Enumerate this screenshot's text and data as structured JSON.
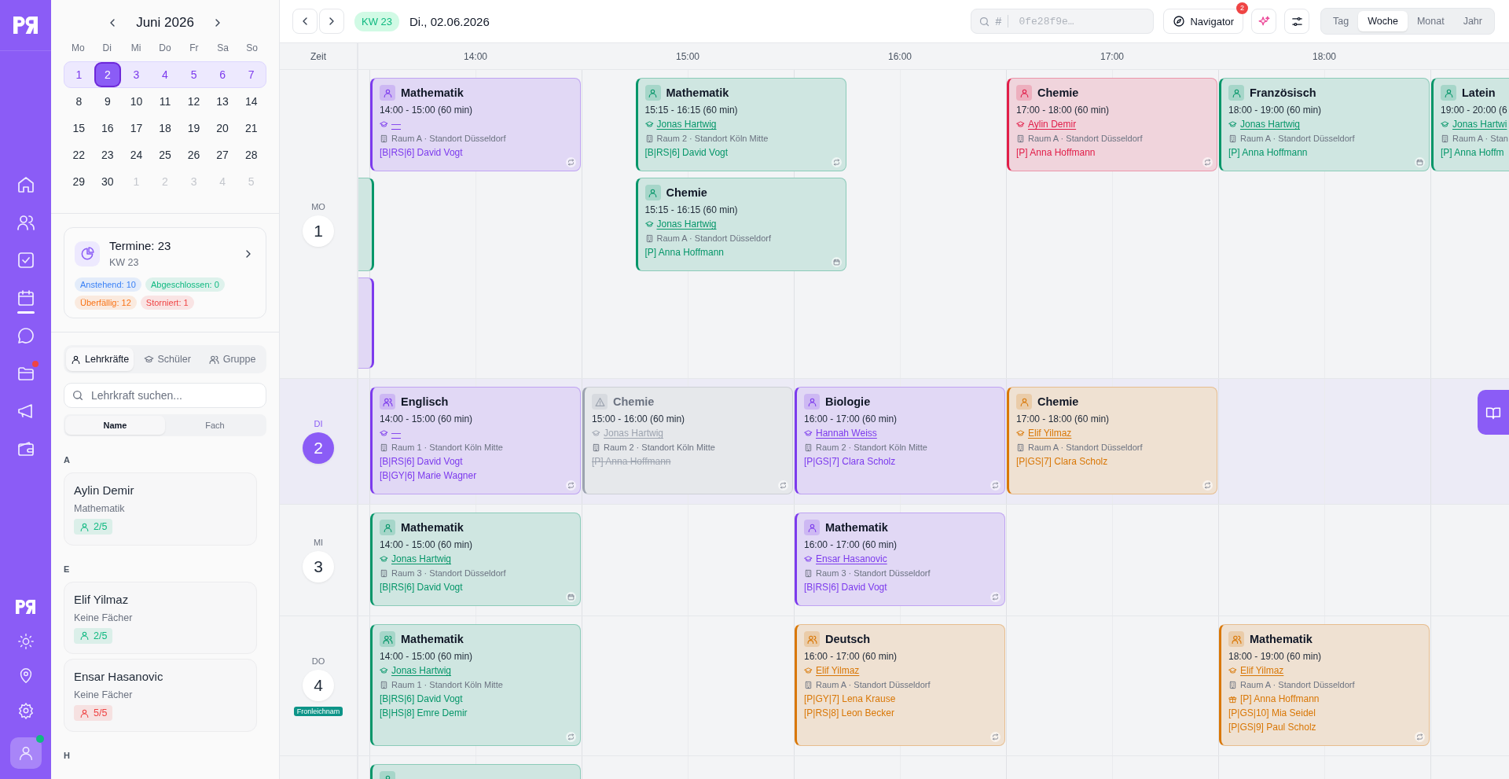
{
  "rail": {
    "items": [
      {
        "selected": false,
        "notification": false
      },
      {
        "selected": false,
        "notification": false
      },
      {
        "selected": false,
        "notification": false
      },
      {
        "selected": true,
        "notification": false
      },
      {
        "selected": false,
        "notification": false
      },
      {
        "selected": false,
        "notification": true
      },
      {
        "selected": false,
        "notification": false
      },
      {
        "selected": false,
        "notification": false
      }
    ],
    "user": {
      "online": true
    }
  },
  "mini_calendar": {
    "month": "Juni 2026",
    "weekdays": [
      "Mo",
      "Di",
      "Mi",
      "Do",
      "Fr",
      "Sa",
      "So"
    ],
    "weeks": [
      {
        "selected": true,
        "days": [
          {
            "label": "1",
            "selected": false,
            "outside": false
          },
          {
            "label": "2",
            "selected": true,
            "outside": false
          },
          {
            "label": "3",
            "selected": false,
            "outside": false
          },
          {
            "label": "4",
            "selected": false,
            "outside": false
          },
          {
            "label": "5",
            "selected": false,
            "outside": false
          },
          {
            "label": "6",
            "selected": false,
            "outside": false
          },
          {
            "label": "7",
            "selected": false,
            "outside": false
          }
        ]
      },
      {
        "selected": false,
        "days": [
          {
            "label": "8",
            "selected": false,
            "outside": false
          },
          {
            "label": "9",
            "selected": false,
            "outside": false
          },
          {
            "label": "10",
            "selected": false,
            "outside": false
          },
          {
            "label": "11",
            "selected": false,
            "outside": false
          },
          {
            "label": "12",
            "selected": false,
            "outside": false
          },
          {
            "label": "13",
            "selected": false,
            "outside": false
          },
          {
            "label": "14",
            "selected": false,
            "outside": false
          }
        ]
      },
      {
        "selected": false,
        "days": [
          {
            "label": "15",
            "selected": false,
            "outside": false
          },
          {
            "label": "16",
            "selected": false,
            "outside": false
          },
          {
            "label": "17",
            "selected": false,
            "outside": false
          },
          {
            "label": "18",
            "selected": false,
            "outside": false
          },
          {
            "label": "19",
            "selected": false,
            "outside": false
          },
          {
            "label": "20",
            "selected": false,
            "outside": false
          },
          {
            "label": "21",
            "selected": false,
            "outside": false
          }
        ]
      },
      {
        "selected": false,
        "days": [
          {
            "label": "22",
            "selected": false,
            "outside": false
          },
          {
            "label": "23",
            "selected": false,
            "outside": false
          },
          {
            "label": "24",
            "selected": false,
            "outside": false
          },
          {
            "label": "25",
            "selected": false,
            "outside": false
          },
          {
            "label": "26",
            "selected": false,
            "outside": false
          },
          {
            "label": "27",
            "selected": false,
            "outside": false
          },
          {
            "label": "28",
            "selected": false,
            "outside": false
          }
        ]
      },
      {
        "selected": false,
        "days": [
          {
            "label": "29",
            "selected": false,
            "outside": false
          },
          {
            "label": "30",
            "selected": false,
            "outside": false
          },
          {
            "label": "1",
            "selected": false,
            "outside": true
          },
          {
            "label": "2",
            "selected": false,
            "outside": true
          },
          {
            "label": "3",
            "selected": false,
            "outside": true
          },
          {
            "label": "4",
            "selected": false,
            "outside": true
          },
          {
            "label": "5",
            "selected": false,
            "outside": true
          }
        ]
      }
    ]
  },
  "summary": {
    "title": "Termine: 23",
    "subtitle": "KW 23",
    "chips": [
      {
        "label": "Anstehend: 10",
        "color": "#3b82f6"
      },
      {
        "label": "Abgeschlossen: 0",
        "color": "#10b981"
      },
      {
        "label": "Überfällig: 12",
        "color": "#f97316"
      },
      {
        "label": "Storniert: 1",
        "color": "#ef4444"
      }
    ]
  },
  "people_tabs": [
    {
      "label": "Lehrkräfte",
      "selected": true
    },
    {
      "label": "Schüler",
      "selected": false
    },
    {
      "label": "Gruppe",
      "selected": false
    }
  ],
  "people_search": {
    "placeholder": "Lehrkraft suchen..."
  },
  "sort": [
    {
      "label": "Name",
      "selected": true
    },
    {
      "label": "Fach",
      "selected": false
    }
  ],
  "groups": [
    {
      "letter": "A",
      "teachers": [
        {
          "name": "Aylin Demir",
          "subject": "Mathematik",
          "load": "2/5",
          "color": "#10b981"
        }
      ]
    },
    {
      "letter": "E",
      "teachers": [
        {
          "name": "Elif Yilmaz",
          "subject": "Keine Fächer",
          "load": "2/5",
          "color": "#10b981"
        },
        {
          "name": "Ensar Hasanovic",
          "subject": "Keine Fächer",
          "load": "5/5",
          "color": "#ef4444"
        }
      ]
    },
    {
      "letter": "H"
    }
  ],
  "toolbar": {
    "week_badge": "KW 23",
    "date": "Di., 02.06.2026",
    "search": {
      "prefix": "#",
      "placeholder": "0fe28f9e…"
    },
    "navigator": {
      "label": "Navigator",
      "badge": "2"
    },
    "views": [
      {
        "label": "Tag",
        "selected": false
      },
      {
        "label": "Woche",
        "selected": true
      },
      {
        "label": "Monat",
        "selected": false
      },
      {
        "label": "Jahr",
        "selected": false
      }
    ]
  },
  "grid": {
    "time_header": "Zeit",
    "hours": [
      "14:00",
      "15:00",
      "16:00",
      "17:00",
      "18:00"
    ],
    "days": [
      {
        "weekday": "MO",
        "date": "1",
        "selected": false,
        "lanes": [
          [
            {
              "kind": "full",
              "color": "#7c3aed",
              "title": "Mathematik",
              "time": "14:00 - 15:00 (60 min)",
              "teacher": "—",
              "room": "Raum A · Standort Düsseldorf",
              "participants": [
                {
                  "text": "[B|RS|6] David Vogt",
                  "gift": false
                }
              ],
              "recurring": true,
              "cancelled": false
            },
            {
              "kind": "full",
              "color": "#059669",
              "title": "Mathematik",
              "time": "15:15 - 16:15 (60 min)",
              "teacher": "Jonas Hartwig",
              "room": "Raum 2 · Standort Köln Mitte",
              "participants": [
                {
                  "text": "[B|RS|6] David Vogt",
                  "gift": false
                }
              ],
              "recurring": true,
              "cancelled": false
            },
            {
              "kind": "full",
              "color": "#e11d48",
              "title": "Chemie",
              "time": "17:00 - 18:00 (60 min)",
              "teacher": "Aylin Demir",
              "room": "Raum A · Standort Düsseldorf",
              "participants": [
                {
                  "text": "[P] Anna Hoffmann",
                  "gift": false
                }
              ],
              "recurring": true,
              "cancelled": false
            },
            {
              "kind": "full",
              "color": "#059669",
              "title": "Französisch",
              "time": "18:00 - 19:00 (60 min)",
              "teacher": "Jonas Hartwig",
              "room": "Raum A · Standort Düsseldorf",
              "participants": [
                {
                  "text": "[P] Anna Hoffmann",
                  "gift": false
                }
              ],
              "recurring": false,
              "cancelled": false
            },
            {
              "kind": "full",
              "color": "#059669",
              "title": "Latein",
              "time": "19:00 - 20:00 (6",
              "teacher": "Jonas Hartwi",
              "room": "Raum A · Stan",
              "participants": [
                {
                  "text": "[P] Anna Hoffm",
                  "gift": false
                }
              ],
              "cancelled": false
            }
          ],
          [
            {
              "kind": "cut",
              "color": "#059669"
            },
            {
              "kind": "full",
              "color": "#059669",
              "title": "Chemie",
              "time": "15:15 - 16:15 (60 min)",
              "teacher": "Jonas Hartwig",
              "room": "Raum A · Standort Düsseldorf",
              "participants": [
                {
                  "text": "[P] Anna Hoffmann",
                  "gift": false
                }
              ],
              "recurring": false,
              "cancelled": false
            }
          ],
          [
            {
              "kind": "cut",
              "color": "#7c3aed"
            }
          ]
        ]
      },
      {
        "weekday": "DI",
        "date": "2",
        "selected": true,
        "lanes": [
          [
            {
              "kind": "full",
              "color": "#7c3aed",
              "title": "Englisch",
              "time": "14:00 - 15:00 (60 min)",
              "teacher": "—",
              "room": "Raum 1 · Standort Köln Mitte",
              "participants": [
                {
                  "text": "[B|RS|6] David Vogt",
                  "gift": false
                },
                {
                  "text": "[B|GY|6] Marie Wagner",
                  "gift": false
                }
              ],
              "recurring": true,
              "cancelled": false
            },
            {
              "kind": "full",
              "color": "#9ca3af",
              "title": "Chemie",
              "time": "15:00 - 16:00 (60 min)",
              "teacher": "Jonas Hartwig",
              "room": "Raum 2 · Standort Köln Mitte",
              "participants": [
                {
                  "text": "[P] Anna Hoffmann",
                  "gift": false
                }
              ],
              "recurring": true,
              "cancelled": true
            },
            {
              "kind": "full",
              "color": "#7c3aed",
              "title": "Biologie",
              "time": "16:00 - 17:00 (60 min)",
              "teacher": "Hannah Weiss",
              "room": "Raum 2 · Standort Köln Mitte",
              "participants": [
                {
                  "text": "[P|GS|7] Clara Scholz",
                  "gift": false
                }
              ],
              "recurring": true,
              "cancelled": false
            },
            {
              "kind": "full",
              "color": "#d97706",
              "title": "Chemie",
              "time": "17:00 - 18:00 (60 min)",
              "teacher": "Elif Yilmaz",
              "room": "Raum A · Standort Düsseldorf",
              "participants": [
                {
                  "text": "[P|GS|7] Clara Scholz",
                  "gift": false
                }
              ],
              "recurring": true,
              "cancelled": false
            }
          ]
        ]
      },
      {
        "weekday": "MI",
        "date": "3",
        "selected": false,
        "lanes": [
          [
            {
              "kind": "full",
              "color": "#059669",
              "title": "Mathematik",
              "time": "14:00 - 15:00 (60 min)",
              "teacher": "Jonas Hartwig",
              "room": "Raum 3 · Standort Düsseldorf",
              "participants": [
                {
                  "text": "[B|RS|6] David Vogt",
                  "gift": false
                }
              ],
              "recurring": false,
              "cancelled": false
            },
            {
              "kind": "full",
              "color": "#7c3aed",
              "title": "Mathematik",
              "time": "16:00 - 17:00 (60 min)",
              "teacher": "Ensar Hasanovic",
              "room": "Raum 3 · Standort Düsseldorf",
              "participants": [
                {
                  "text": "[B|RS|6] David Vogt",
                  "gift": false
                }
              ],
              "recurring": true,
              "cancelled": false
            }
          ]
        ]
      },
      {
        "weekday": "DO",
        "date": "4",
        "selected": false,
        "holiday": "Fronleichnam",
        "lanes": [
          [
            {
              "kind": "full",
              "color": "#059669",
              "title": "Mathematik",
              "time": "14:00 - 15:00 (60 min)",
              "teacher": "Jonas Hartwig",
              "room": "Raum 1 · Standort Köln Mitte",
              "participants": [
                {
                  "text": "[B|RS|6] David Vogt",
                  "gift": false
                },
                {
                  "text": "[B|HS|8] Emre Demir",
                  "gift": false
                }
              ],
              "recurring": true,
              "cancelled": false
            },
            {
              "kind": "full",
              "color": "#d97706",
              "title": "Deutsch",
              "time": "16:00 - 17:00 (60 min)",
              "teacher": "Elif Yilmaz",
              "room": "Raum A · Standort Düsseldorf",
              "participants": [
                {
                  "text": "[P|GY|7] Lena Krause",
                  "gift": false
                },
                {
                  "text": "[P|RS|8] Leon Becker",
                  "gift": false
                }
              ],
              "recurring": true,
              "cancelled": false
            },
            {
              "kind": "full",
              "color": "#d97706",
              "title": "Mathematik",
              "time": "18:00 - 19:00 (60 min)",
              "teacher": "Elif Yilmaz",
              "room": "Raum A · Standort Düsseldorf",
              "participants": [
                {
                  "text": "[P] Anna Hoffmann",
                  "gift": true
                },
                {
                  "text": "[P|GS|10] Mia Seidel",
                  "gift": false
                },
                {
                  "text": "[P|GS|9] Paul Scholz",
                  "gift": false
                }
              ],
              "recurring": true,
              "cancelled": false
            }
          ]
        ]
      },
      {
        "lanes": [
          [
            {
              "kind": "stub",
              "color": "#059669"
            }
          ]
        ]
      }
    ]
  }
}
